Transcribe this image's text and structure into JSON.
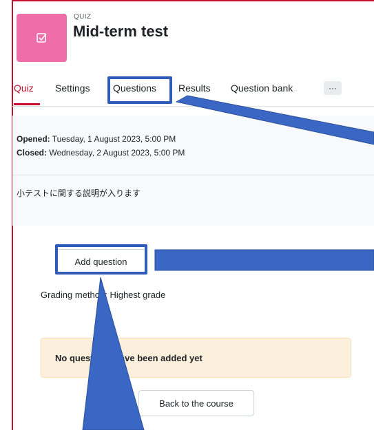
{
  "header": {
    "module_type": "QUIZ",
    "title": "Mid-term test",
    "icon": "quiz-checkbox-icon",
    "icon_bg": "#ef6ea9"
  },
  "tabs": [
    {
      "label": "Quiz",
      "active": true
    },
    {
      "label": "Settings"
    },
    {
      "label": "Questions"
    },
    {
      "label": "Results"
    },
    {
      "label": "Question bank"
    },
    {
      "label": "···"
    }
  ],
  "info": {
    "opened_label": "Opened:",
    "opened_value": " Tuesday, 1 August 2023, 5:00 PM",
    "closed_label": "Closed:",
    "closed_value": " Wednesday, 2 August 2023, 5:00 PM",
    "description": "小テストに関する説明が入ります"
  },
  "actions": {
    "add_question": "Add question",
    "grading_method": "Grading method: Highest grade",
    "no_questions": "No questions have been added yet",
    "back": "Back to the course"
  },
  "colors": {
    "accent": "#c8102e",
    "annotation": "#3a67c4",
    "alert_bg": "#fcefdc"
  }
}
